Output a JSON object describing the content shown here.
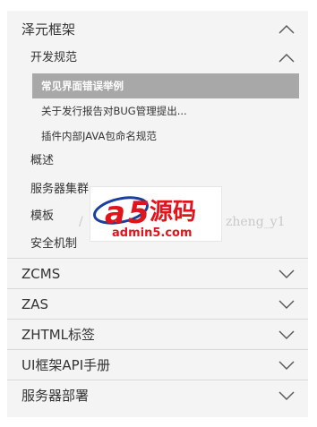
{
  "nav": {
    "sections": [
      {
        "label": "泽元框架",
        "expanded": true
      },
      {
        "label": "ZCMS",
        "expanded": false
      },
      {
        "label": "ZAS",
        "expanded": false
      },
      {
        "label": "ZHTML标签",
        "expanded": false
      },
      {
        "label": "UI框架API手册",
        "expanded": false
      },
      {
        "label": "服务器部署",
        "expanded": false
      }
    ],
    "framework_children": {
      "subgroup": {
        "label": "开发规范",
        "expanded": true
      },
      "subgroup_items": [
        {
          "label": "常见界面错误举例",
          "active": true
        },
        {
          "label": "关于发行报告对BUG管理提出...",
          "active": false
        },
        {
          "label": "插件内部JAVA包命名规范",
          "active": false
        }
      ],
      "items": [
        {
          "label": "概述"
        },
        {
          "label": "服务器集群"
        },
        {
          "label": "模板"
        },
        {
          "label": "安全机制"
        }
      ]
    }
  },
  "watermark": {
    "left_text": "/",
    "right_text": "zheng_y1",
    "logo_prefix": "a",
    "logo_digit": "5",
    "logo_cn": "源码",
    "logo_url": "admin5.com"
  },
  "colors": {
    "panel_bg": "#f4f4f4",
    "active_bg": "#a8a8a8",
    "divider": "#d8d8d8",
    "logo_red": "#e1141b",
    "logo_blue": "#1a3fa0"
  }
}
